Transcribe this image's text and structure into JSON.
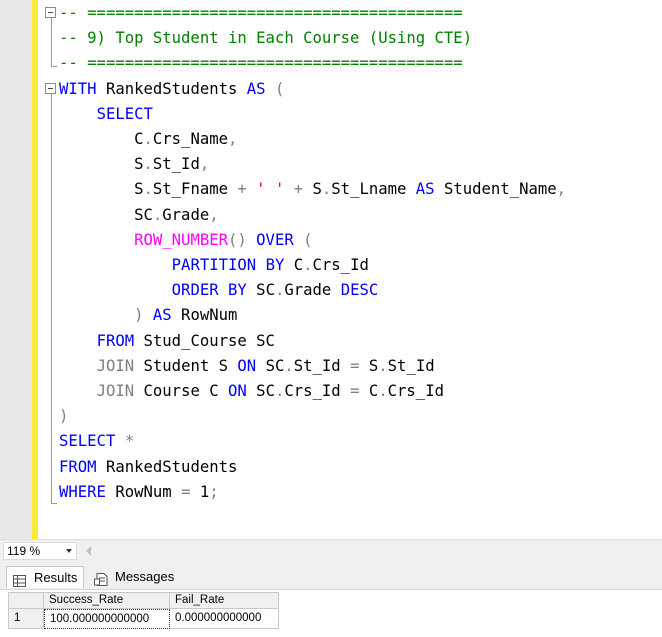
{
  "editor": {
    "lines": [
      {
        "indent": 0,
        "tokens": [
          {
            "t": "-- ========================================",
            "c": "comment"
          }
        ]
      },
      {
        "indent": 0,
        "tokens": [
          {
            "t": "-- 9) Top Student in Each Course (Using CTE)",
            "c": "comment"
          }
        ]
      },
      {
        "indent": 0,
        "tokens": [
          {
            "t": "-- ========================================",
            "c": "comment"
          }
        ]
      },
      {
        "indent": 0,
        "tokens": [
          {
            "t": "WITH",
            "c": "keyword"
          },
          {
            "t": " RankedStudents ",
            "c": "plain"
          },
          {
            "t": "AS",
            "c": "keyword"
          },
          {
            "t": " (",
            "c": "operator"
          }
        ]
      },
      {
        "indent": 4,
        "tokens": [
          {
            "t": "SELECT",
            "c": "keyword"
          }
        ]
      },
      {
        "indent": 8,
        "tokens": [
          {
            "t": "C",
            "c": "plain"
          },
          {
            "t": ".",
            "c": "operator"
          },
          {
            "t": "Crs_Name",
            "c": "plain"
          },
          {
            "t": ",",
            "c": "operator"
          }
        ]
      },
      {
        "indent": 8,
        "tokens": [
          {
            "t": "S",
            "c": "plain"
          },
          {
            "t": ".",
            "c": "operator"
          },
          {
            "t": "St_Id",
            "c": "plain"
          },
          {
            "t": ",",
            "c": "operator"
          }
        ]
      },
      {
        "indent": 8,
        "tokens": [
          {
            "t": "S",
            "c": "plain"
          },
          {
            "t": ".",
            "c": "operator"
          },
          {
            "t": "St_Fname ",
            "c": "plain"
          },
          {
            "t": "+",
            "c": "operator"
          },
          {
            "t": " ",
            "c": "plain"
          },
          {
            "t": "' '",
            "c": "string"
          },
          {
            "t": " ",
            "c": "plain"
          },
          {
            "t": "+",
            "c": "operator"
          },
          {
            "t": " S",
            "c": "plain"
          },
          {
            "t": ".",
            "c": "operator"
          },
          {
            "t": "St_Lname ",
            "c": "plain"
          },
          {
            "t": "AS",
            "c": "keyword"
          },
          {
            "t": " Student_Name",
            "c": "plain"
          },
          {
            "t": ",",
            "c": "operator"
          }
        ]
      },
      {
        "indent": 8,
        "tokens": [
          {
            "t": "SC",
            "c": "plain"
          },
          {
            "t": ".",
            "c": "operator"
          },
          {
            "t": "Grade",
            "c": "plain"
          },
          {
            "t": ",",
            "c": "operator"
          }
        ]
      },
      {
        "indent": 8,
        "tokens": [
          {
            "t": "ROW_NUMBER",
            "c": "function"
          },
          {
            "t": "()",
            "c": "operator"
          },
          {
            "t": " ",
            "c": "plain"
          },
          {
            "t": "OVER",
            "c": "keyword"
          },
          {
            "t": " (",
            "c": "operator"
          }
        ]
      },
      {
        "indent": 12,
        "tokens": [
          {
            "t": "PARTITION",
            "c": "keyword"
          },
          {
            "t": " ",
            "c": "plain"
          },
          {
            "t": "BY",
            "c": "keyword"
          },
          {
            "t": " C",
            "c": "plain"
          },
          {
            "t": ".",
            "c": "operator"
          },
          {
            "t": "Crs_Id",
            "c": "plain"
          }
        ]
      },
      {
        "indent": 12,
        "tokens": [
          {
            "t": "ORDER",
            "c": "keyword"
          },
          {
            "t": " ",
            "c": "plain"
          },
          {
            "t": "BY",
            "c": "keyword"
          },
          {
            "t": " SC",
            "c": "plain"
          },
          {
            "t": ".",
            "c": "operator"
          },
          {
            "t": "Grade ",
            "c": "plain"
          },
          {
            "t": "DESC",
            "c": "keyword"
          }
        ]
      },
      {
        "indent": 8,
        "tokens": [
          {
            "t": ")",
            "c": "operator"
          },
          {
            "t": " ",
            "c": "plain"
          },
          {
            "t": "AS",
            "c": "keyword"
          },
          {
            "t": " RowNum",
            "c": "plain"
          }
        ]
      },
      {
        "indent": 4,
        "tokens": [
          {
            "t": "FROM",
            "c": "keyword"
          },
          {
            "t": " Stud_Course SC",
            "c": "plain"
          }
        ]
      },
      {
        "indent": 4,
        "tokens": [
          {
            "t": "JOIN",
            "c": "operator"
          },
          {
            "t": " Student S ",
            "c": "plain"
          },
          {
            "t": "ON",
            "c": "keyword"
          },
          {
            "t": " SC",
            "c": "plain"
          },
          {
            "t": ".",
            "c": "operator"
          },
          {
            "t": "St_Id ",
            "c": "plain"
          },
          {
            "t": "=",
            "c": "operator"
          },
          {
            "t": " S",
            "c": "plain"
          },
          {
            "t": ".",
            "c": "operator"
          },
          {
            "t": "St_Id",
            "c": "plain"
          }
        ]
      },
      {
        "indent": 4,
        "tokens": [
          {
            "t": "JOIN",
            "c": "operator"
          },
          {
            "t": " Course C ",
            "c": "plain"
          },
          {
            "t": "ON",
            "c": "keyword"
          },
          {
            "t": " SC",
            "c": "plain"
          },
          {
            "t": ".",
            "c": "operator"
          },
          {
            "t": "Crs_Id ",
            "c": "plain"
          },
          {
            "t": "=",
            "c": "operator"
          },
          {
            "t": " C",
            "c": "plain"
          },
          {
            "t": ".",
            "c": "operator"
          },
          {
            "t": "Crs_Id",
            "c": "plain"
          }
        ]
      },
      {
        "indent": 0,
        "tokens": [
          {
            "t": ")",
            "c": "operator"
          }
        ]
      },
      {
        "indent": 0,
        "tokens": [
          {
            "t": "SELECT",
            "c": "keyword"
          },
          {
            "t": " ",
            "c": "plain"
          },
          {
            "t": "*",
            "c": "operator"
          }
        ]
      },
      {
        "indent": 0,
        "tokens": [
          {
            "t": "FROM",
            "c": "keyword"
          },
          {
            "t": " RankedStudents",
            "c": "plain"
          }
        ]
      },
      {
        "indent": 0,
        "tokens": [
          {
            "t": "WHERE",
            "c": "keyword"
          },
          {
            "t": " RowNum ",
            "c": "plain"
          },
          {
            "t": "=",
            "c": "operator"
          },
          {
            "t": " 1",
            "c": "plain"
          },
          {
            "t": ";",
            "c": "operator"
          }
        ]
      }
    ]
  },
  "statusbar": {
    "zoom": "119 %"
  },
  "tabs": {
    "results_label": "Results",
    "messages_label": "Messages"
  },
  "grid": {
    "columns": [
      "Success_Rate",
      "Fail_Rate"
    ],
    "rows": [
      {
        "num": "1",
        "cells": [
          "100.000000000000",
          "0.000000000000"
        ]
      }
    ]
  },
  "colors": {
    "keyword": "#0000ff",
    "comment": "#008000",
    "function": "#ff00ff",
    "operator": "#808080",
    "string": "#ff0000"
  }
}
